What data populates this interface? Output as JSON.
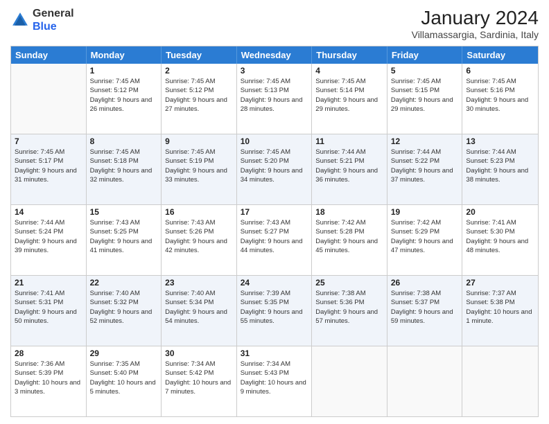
{
  "logo": {
    "general": "General",
    "blue": "Blue"
  },
  "header": {
    "title": "January 2024",
    "subtitle": "Villamassargia, Sardinia, Italy"
  },
  "days": [
    "Sunday",
    "Monday",
    "Tuesday",
    "Wednesday",
    "Thursday",
    "Friday",
    "Saturday"
  ],
  "weeks": [
    [
      {
        "day": "",
        "sunrise": "",
        "sunset": "",
        "daylight": ""
      },
      {
        "day": "1",
        "sunrise": "Sunrise: 7:45 AM",
        "sunset": "Sunset: 5:12 PM",
        "daylight": "Daylight: 9 hours and 26 minutes."
      },
      {
        "day": "2",
        "sunrise": "Sunrise: 7:45 AM",
        "sunset": "Sunset: 5:12 PM",
        "daylight": "Daylight: 9 hours and 27 minutes."
      },
      {
        "day": "3",
        "sunrise": "Sunrise: 7:45 AM",
        "sunset": "Sunset: 5:13 PM",
        "daylight": "Daylight: 9 hours and 28 minutes."
      },
      {
        "day": "4",
        "sunrise": "Sunrise: 7:45 AM",
        "sunset": "Sunset: 5:14 PM",
        "daylight": "Daylight: 9 hours and 29 minutes."
      },
      {
        "day": "5",
        "sunrise": "Sunrise: 7:45 AM",
        "sunset": "Sunset: 5:15 PM",
        "daylight": "Daylight: 9 hours and 29 minutes."
      },
      {
        "day": "6",
        "sunrise": "Sunrise: 7:45 AM",
        "sunset": "Sunset: 5:16 PM",
        "daylight": "Daylight: 9 hours and 30 minutes."
      }
    ],
    [
      {
        "day": "7",
        "sunrise": "Sunrise: 7:45 AM",
        "sunset": "Sunset: 5:17 PM",
        "daylight": "Daylight: 9 hours and 31 minutes."
      },
      {
        "day": "8",
        "sunrise": "Sunrise: 7:45 AM",
        "sunset": "Sunset: 5:18 PM",
        "daylight": "Daylight: 9 hours and 32 minutes."
      },
      {
        "day": "9",
        "sunrise": "Sunrise: 7:45 AM",
        "sunset": "Sunset: 5:19 PM",
        "daylight": "Daylight: 9 hours and 33 minutes."
      },
      {
        "day": "10",
        "sunrise": "Sunrise: 7:45 AM",
        "sunset": "Sunset: 5:20 PM",
        "daylight": "Daylight: 9 hours and 34 minutes."
      },
      {
        "day": "11",
        "sunrise": "Sunrise: 7:44 AM",
        "sunset": "Sunset: 5:21 PM",
        "daylight": "Daylight: 9 hours and 36 minutes."
      },
      {
        "day": "12",
        "sunrise": "Sunrise: 7:44 AM",
        "sunset": "Sunset: 5:22 PM",
        "daylight": "Daylight: 9 hours and 37 minutes."
      },
      {
        "day": "13",
        "sunrise": "Sunrise: 7:44 AM",
        "sunset": "Sunset: 5:23 PM",
        "daylight": "Daylight: 9 hours and 38 minutes."
      }
    ],
    [
      {
        "day": "14",
        "sunrise": "Sunrise: 7:44 AM",
        "sunset": "Sunset: 5:24 PM",
        "daylight": "Daylight: 9 hours and 39 minutes."
      },
      {
        "day": "15",
        "sunrise": "Sunrise: 7:43 AM",
        "sunset": "Sunset: 5:25 PM",
        "daylight": "Daylight: 9 hours and 41 minutes."
      },
      {
        "day": "16",
        "sunrise": "Sunrise: 7:43 AM",
        "sunset": "Sunset: 5:26 PM",
        "daylight": "Daylight: 9 hours and 42 minutes."
      },
      {
        "day": "17",
        "sunrise": "Sunrise: 7:43 AM",
        "sunset": "Sunset: 5:27 PM",
        "daylight": "Daylight: 9 hours and 44 minutes."
      },
      {
        "day": "18",
        "sunrise": "Sunrise: 7:42 AM",
        "sunset": "Sunset: 5:28 PM",
        "daylight": "Daylight: 9 hours and 45 minutes."
      },
      {
        "day": "19",
        "sunrise": "Sunrise: 7:42 AM",
        "sunset": "Sunset: 5:29 PM",
        "daylight": "Daylight: 9 hours and 47 minutes."
      },
      {
        "day": "20",
        "sunrise": "Sunrise: 7:41 AM",
        "sunset": "Sunset: 5:30 PM",
        "daylight": "Daylight: 9 hours and 48 minutes."
      }
    ],
    [
      {
        "day": "21",
        "sunrise": "Sunrise: 7:41 AM",
        "sunset": "Sunset: 5:31 PM",
        "daylight": "Daylight: 9 hours and 50 minutes."
      },
      {
        "day": "22",
        "sunrise": "Sunrise: 7:40 AM",
        "sunset": "Sunset: 5:32 PM",
        "daylight": "Daylight: 9 hours and 52 minutes."
      },
      {
        "day": "23",
        "sunrise": "Sunrise: 7:40 AM",
        "sunset": "Sunset: 5:34 PM",
        "daylight": "Daylight: 9 hours and 54 minutes."
      },
      {
        "day": "24",
        "sunrise": "Sunrise: 7:39 AM",
        "sunset": "Sunset: 5:35 PM",
        "daylight": "Daylight: 9 hours and 55 minutes."
      },
      {
        "day": "25",
        "sunrise": "Sunrise: 7:38 AM",
        "sunset": "Sunset: 5:36 PM",
        "daylight": "Daylight: 9 hours and 57 minutes."
      },
      {
        "day": "26",
        "sunrise": "Sunrise: 7:38 AM",
        "sunset": "Sunset: 5:37 PM",
        "daylight": "Daylight: 9 hours and 59 minutes."
      },
      {
        "day": "27",
        "sunrise": "Sunrise: 7:37 AM",
        "sunset": "Sunset: 5:38 PM",
        "daylight": "Daylight: 10 hours and 1 minute."
      }
    ],
    [
      {
        "day": "28",
        "sunrise": "Sunrise: 7:36 AM",
        "sunset": "Sunset: 5:39 PM",
        "daylight": "Daylight: 10 hours and 3 minutes."
      },
      {
        "day": "29",
        "sunrise": "Sunrise: 7:35 AM",
        "sunset": "Sunset: 5:40 PM",
        "daylight": "Daylight: 10 hours and 5 minutes."
      },
      {
        "day": "30",
        "sunrise": "Sunrise: 7:34 AM",
        "sunset": "Sunset: 5:42 PM",
        "daylight": "Daylight: 10 hours and 7 minutes."
      },
      {
        "day": "31",
        "sunrise": "Sunrise: 7:34 AM",
        "sunset": "Sunset: 5:43 PM",
        "daylight": "Daylight: 10 hours and 9 minutes."
      },
      {
        "day": "",
        "sunrise": "",
        "sunset": "",
        "daylight": ""
      },
      {
        "day": "",
        "sunrise": "",
        "sunset": "",
        "daylight": ""
      },
      {
        "day": "",
        "sunrise": "",
        "sunset": "",
        "daylight": ""
      }
    ]
  ]
}
